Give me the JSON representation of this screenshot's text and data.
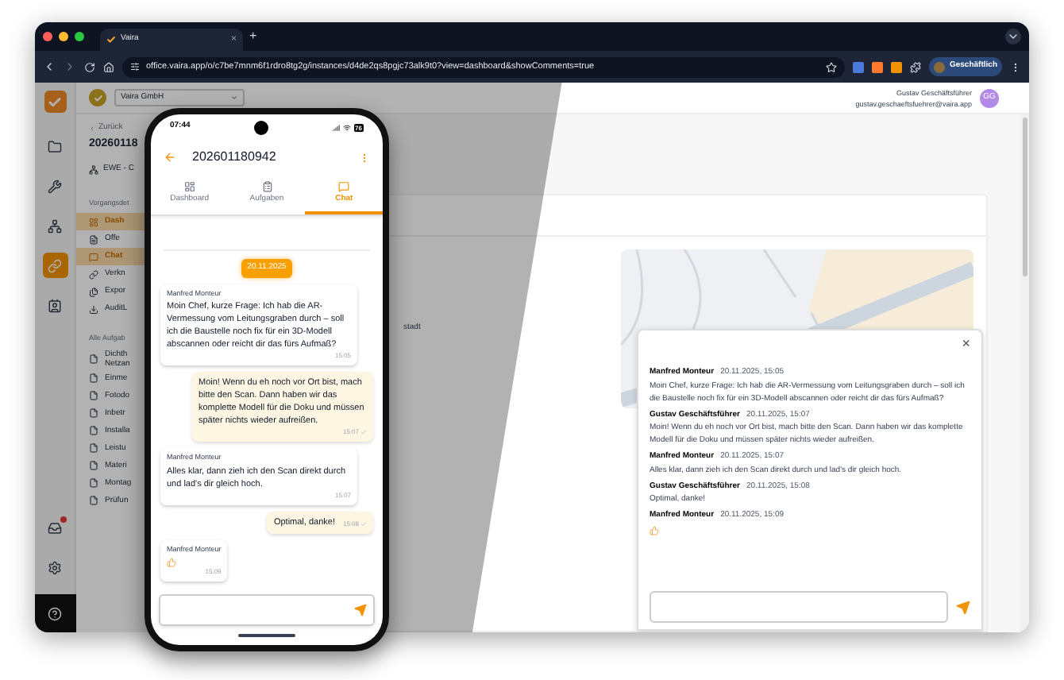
{
  "browser": {
    "tab_title": "Vaira",
    "tab_close": "×",
    "new_tab": "+",
    "url": "office.vaira.app/o/c7be7mnm6f1rdro8tg2g/instances/d4de2qs8pgjc73alk9t0?view=dashboard&showComments=true",
    "profile": "Geschäftlich"
  },
  "app": {
    "org_select": "Vaira GmbH",
    "user_name": "Gustav Geschäftsführer",
    "user_email": "gustav.geschaeftsfuehrer@vaira.app",
    "user_initials": "GG",
    "rail": [
      {
        "kind": "folder",
        "selected": false
      },
      {
        "kind": "tools",
        "selected": false
      },
      {
        "kind": "network",
        "selected": false
      },
      {
        "kind": "link",
        "selected": true
      },
      {
        "kind": "contact",
        "selected": false
      }
    ],
    "rail_bottom": [
      {
        "kind": "inbox",
        "badge": true
      },
      {
        "kind": "settings",
        "badge": false
      },
      {
        "kind": "help",
        "badge": false
      }
    ],
    "back": "Zurück",
    "record_title": "20260118",
    "customer": "EWE - C",
    "detail_heading": "Vorgangsdet",
    "nav": [
      {
        "kind": "dashboard",
        "label": "Dash",
        "selected": true
      },
      {
        "kind": "offer",
        "label": "Offe",
        "selected": false
      },
      {
        "kind": "chat",
        "label": "Chat",
        "selected": true
      },
      {
        "kind": "link",
        "label": "Verkn",
        "selected": false
      },
      {
        "kind": "export",
        "label": "Expor",
        "selected": false
      },
      {
        "kind": "download",
        "label": "AuditL",
        "selected": false
      }
    ],
    "tasks_heading": "Alle Aufgab",
    "tasks": [
      {
        "label": "Dichth Netzan"
      },
      {
        "label": "Einme"
      },
      {
        "label": "Fotodo"
      },
      {
        "label": "Inbetr"
      },
      {
        "label": "Installa"
      },
      {
        "label": "Leistu"
      },
      {
        "label": "Materi"
      },
      {
        "label": "Montag"
      },
      {
        "label": "Prüfun"
      }
    ],
    "main_fragment": "stadt"
  },
  "comments": {
    "close": "×",
    "messages": [
      {
        "author": "Manfred Monteur",
        "time": "20.11.2025, 15:05",
        "kind": "text",
        "text": "Moin Chef, kurze Frage: Ich hab die AR-Vermessung vom Leitungsgraben durch – soll ich die Baustelle noch fix für ein 3D-Modell abscannen oder reicht dir das fürs Aufmaß?"
      },
      {
        "author": "Gustav Geschäftsführer",
        "time": "20.11.2025, 15:07",
        "kind": "text",
        "text": "Moin! Wenn du eh noch vor Ort bist, mach bitte den Scan. Dann haben wir das komplette Modell für die Doku und müssen später nichts wieder aufreißen."
      },
      {
        "author": "Manfred Monteur",
        "time": "20.11.2025, 15:07",
        "kind": "text",
        "text": "Alles klar, dann zieh ich den Scan direkt durch und lad's dir gleich hoch."
      },
      {
        "author": "Gustav Geschäftsführer",
        "time": "20.11.2025, 15:08",
        "kind": "text",
        "text": "Optimal, danke!"
      },
      {
        "author": "Manfred Monteur",
        "time": "20.11.2025, 15:09",
        "kind": "thumbs_up"
      }
    ]
  },
  "phone": {
    "clock": "07:44",
    "battery": "76",
    "title": "202601180942",
    "tabs": [
      {
        "label": "Dashboard",
        "kind": "dashboard",
        "selected": false
      },
      {
        "label": "Aufgaben",
        "kind": "tasks",
        "selected": false
      },
      {
        "label": "Chat",
        "kind": "chat",
        "selected": true
      }
    ],
    "date": "20.11.2025",
    "messages": [
      {
        "outgoing": false,
        "kind": "text",
        "sender": "Manfred Monteur",
        "text": "Moin Chef, kurze Frage: Ich hab die AR-Vermessung vom Leitungsgraben durch – soll ich die Baustelle noch fix für ein 3D-Modell abscannen oder reicht dir das fürs Aufmaß?",
        "time": "15:05"
      },
      {
        "outgoing": true,
        "kind": "text",
        "text": "Moin! Wenn du eh noch vor Ort bist, mach bitte den Scan. Dann haben wir das komplette Modell für die Doku und müssen später nichts wieder aufreißen.",
        "time": "15:07",
        "delivered": true
      },
      {
        "outgoing": false,
        "kind": "text",
        "sender": "Manfred Monteur",
        "text": "Alles klar, dann zieh ich den Scan direkt durch und lad's dir gleich hoch.",
        "time": "15:07"
      },
      {
        "outgoing": true,
        "kind": "text",
        "text": "Optimal, danke!",
        "time": "15:08",
        "delivered": true
      },
      {
        "outgoing": false,
        "kind": "thumbs_up",
        "sender": "Manfred Monteur",
        "time": "15:09"
      }
    ]
  }
}
